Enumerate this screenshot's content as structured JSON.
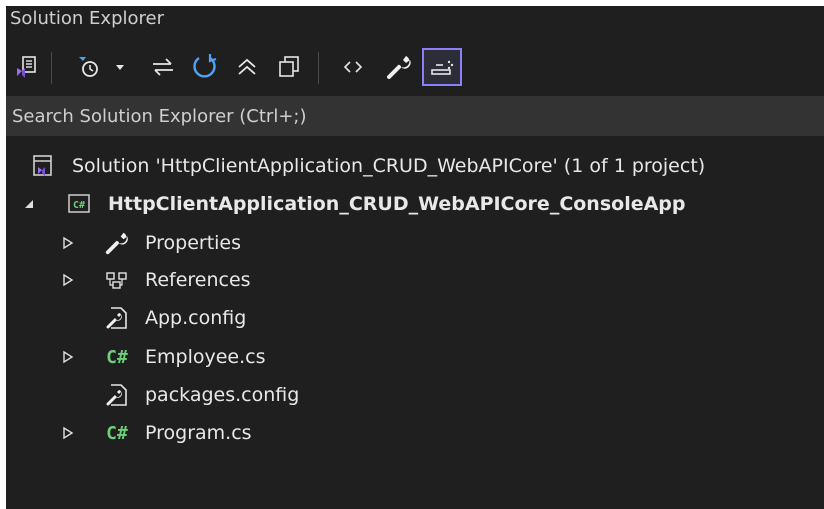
{
  "panel": {
    "title": "Solution Explorer",
    "search_placeholder": "Search Solution Explorer (Ctrl+;)"
  },
  "toolbar": {
    "accent_color": "#8b80f9",
    "buttons": [
      {
        "icon": "switch-views-icon"
      },
      {
        "icon": "pending-changes-filter-icon"
      },
      {
        "icon": "sync-with-active-document-icon"
      },
      {
        "icon": "refresh-icon"
      },
      {
        "icon": "collapse-all-icon"
      },
      {
        "icon": "show-all-files-icon"
      },
      {
        "icon": "preview-code-icon"
      },
      {
        "icon": "properties-wrench-icon"
      },
      {
        "icon": "show-all-files-active-icon"
      }
    ]
  },
  "tree": {
    "solution": {
      "label": "Solution 'HttpClientApplication_CRUD_WebAPICore' (1 of 1 project)",
      "icon": "solution-icon"
    },
    "project": {
      "label": "HttpClientApplication_CRUD_WebAPICore_ConsoleApp",
      "icon": "csharp-project-icon",
      "expanded": true
    },
    "items": [
      {
        "label": "Properties",
        "icon": "wrench-icon",
        "expandable": true
      },
      {
        "label": "References",
        "icon": "references-icon",
        "expandable": true
      },
      {
        "label": "App.config",
        "icon": "config-file-icon",
        "expandable": false
      },
      {
        "label": "Employee.cs",
        "icon": "csharp-file-icon",
        "glyph": "C#",
        "expandable": true
      },
      {
        "label": "packages.config",
        "icon": "config-file-icon",
        "expandable": false
      },
      {
        "label": "Program.cs",
        "icon": "csharp-file-icon",
        "glyph": "C#",
        "expandable": true
      }
    ]
  }
}
